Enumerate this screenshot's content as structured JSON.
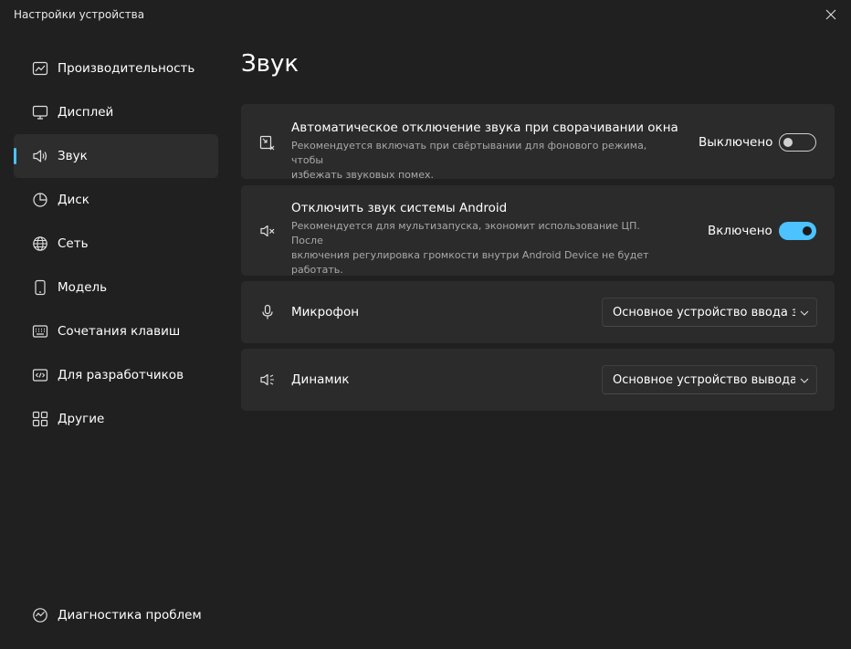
{
  "window": {
    "title": "Настройки устройства"
  },
  "sidebar": {
    "items": [
      {
        "label": "Производительность",
        "icon": "performance-icon"
      },
      {
        "label": "Дисплей",
        "icon": "display-icon"
      },
      {
        "label": "Звук",
        "icon": "speaker-icon",
        "active": true
      },
      {
        "label": "Диск",
        "icon": "disk-icon"
      },
      {
        "label": "Сеть",
        "icon": "globe-icon"
      },
      {
        "label": "Модель",
        "icon": "phone-icon"
      },
      {
        "label": "Сочетания клавиш",
        "icon": "keyboard-icon"
      },
      {
        "label": "Для разработчиков",
        "icon": "code-icon"
      },
      {
        "label": "Другие",
        "icon": "grid-icon"
      }
    ],
    "diagnostics": {
      "label": "Диагностика проблем",
      "icon": "diagnostics-icon"
    }
  },
  "main": {
    "title": "Звук",
    "cards": {
      "auto_mute": {
        "title": "Автоматическое отключение звука при сворачивании окна",
        "desc_line1": "Рекомендуется включать при свёртывании для фонового режима, чтобы",
        "desc_line2": "избежать звуковых помех.",
        "state": "Выключено",
        "enabled": false
      },
      "android_mute": {
        "title": "Отключить звук системы Android",
        "desc_line1": "Рекомендуется для мультизапуска, экономит использование ЦП. После",
        "desc_line2": "включения регулировка громкости внутри Android Device не будет",
        "desc_line3": "работать.",
        "state": "Включено",
        "enabled": true
      },
      "microphone": {
        "title": "Микрофон",
        "value": "Основное устройство ввода звука"
      },
      "speaker": {
        "title": "Динамик",
        "value": "Основное устройство вывода звука"
      }
    }
  },
  "colors": {
    "accent": "#4cc2ff",
    "background": "#202020",
    "card": "#2b2b2b"
  }
}
